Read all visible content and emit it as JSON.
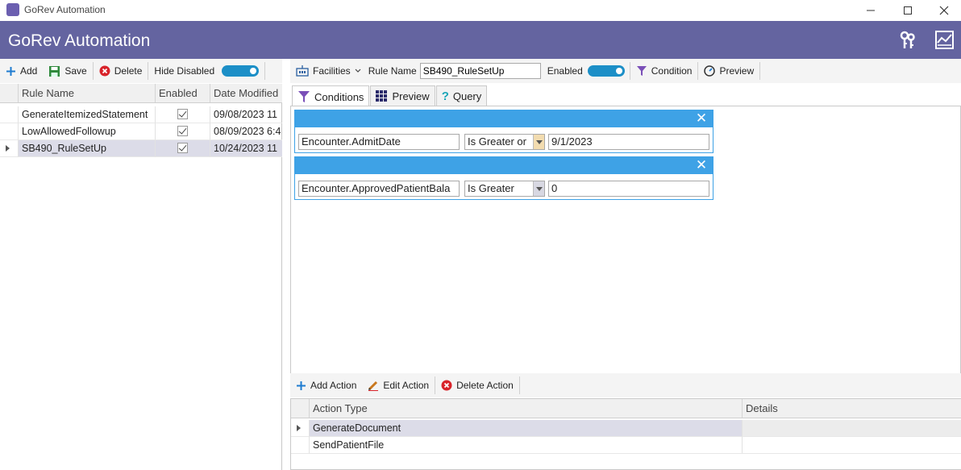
{
  "window": {
    "title": "GoRev Automation",
    "controls": [
      "minimize-icon",
      "maximize-icon",
      "close-icon"
    ]
  },
  "header": {
    "title": "GoRev Automation",
    "icons": [
      "keys-icon",
      "chart-icon"
    ],
    "color": "#6464a0"
  },
  "left_toolbar": {
    "add_label": "Add",
    "save_label": "Save",
    "delete_label": "Delete",
    "hide_disabled_label": "Hide Disabled",
    "hide_disabled_on": true
  },
  "rules_grid": {
    "columns": [
      "Rule Name",
      "Enabled",
      "Date Modified"
    ],
    "rows": [
      {
        "name": "GenerateItemizedStatement",
        "enabled": true,
        "date": "09/08/2023 11"
      },
      {
        "name": "LowAllowedFollowup",
        "enabled": true,
        "date": "08/09/2023 6:4"
      },
      {
        "name": "SB490_RuleSetUp",
        "enabled": true,
        "date": "10/24/2023 11"
      }
    ],
    "selected_index": 2
  },
  "right_toolbar": {
    "facilities_label": "Facilities",
    "rule_name_label": "Rule Name",
    "rule_name_value": "SB490_RuleSetUp",
    "enabled_label": "Enabled",
    "enabled_on": true,
    "condition_label": "Condition",
    "preview_label": "Preview"
  },
  "tabs": {
    "conditions": "Conditions",
    "preview": "Preview",
    "query": "Query",
    "active": "conditions"
  },
  "conditions": [
    {
      "field": "Encounter.AdmitDate",
      "operator": "Is Greater or",
      "value": "9/1/2023"
    },
    {
      "field": "Encounter.ApprovedPatientBala",
      "operator": "Is Greater",
      "value": "0"
    }
  ],
  "actions_toolbar": {
    "add_label": "Add Action",
    "edit_label": "Edit Action",
    "delete_label": "Delete Action"
  },
  "actions_grid": {
    "columns": [
      "Action Type",
      "Details"
    ],
    "rows": [
      {
        "type": "GenerateDocument",
        "details": ""
      },
      {
        "type": "SendPatientFile",
        "details": ""
      }
    ],
    "selected_index": 0
  },
  "colors": {
    "accent": "#3ea2e6",
    "toggle": "#1c8fc7",
    "selected_row": "#dcdce8"
  }
}
